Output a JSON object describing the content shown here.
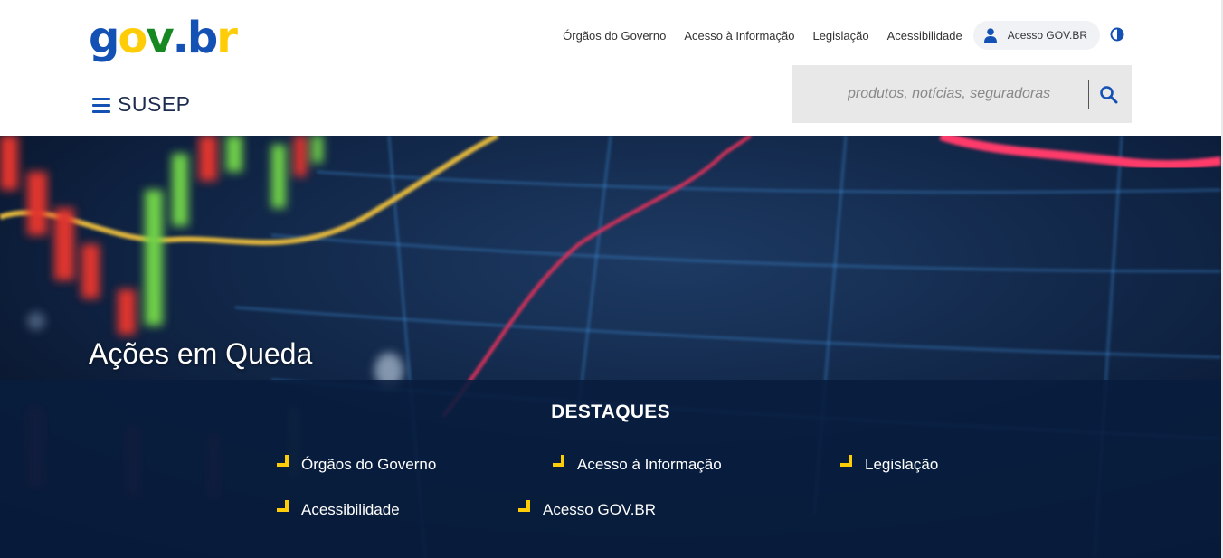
{
  "logo": {
    "parts": [
      "g",
      "o",
      "v",
      ".",
      "b",
      "r"
    ],
    "colors": [
      "#1351b4",
      "#ffcd07",
      "#168821",
      "#1351b4",
      "#1351b4",
      "#ffcd07"
    ]
  },
  "top_nav": {
    "links": [
      "Órgãos do Governo",
      "Acesso à Informação",
      "Legislação",
      "Acessibilidade"
    ],
    "login_label": "Acesso GOV.BR"
  },
  "site": {
    "name": "SUSEP"
  },
  "search": {
    "placeholder": "produtos, notícias, seguradoras"
  },
  "hero": {
    "title": "Ações em Queda"
  },
  "destaques": {
    "title": "DESTAQUES",
    "items": [
      "Órgãos do Governo",
      "Acesso à Informação",
      "Legislação",
      "Acessibilidade",
      "Acesso GOV.BR"
    ]
  },
  "colors": {
    "primary_blue": "#1351b4",
    "accent_yellow": "#ffcd07",
    "brand_green": "#168821",
    "navy_overlay": "#081c3e"
  },
  "icons": {
    "menu": "hamburger-icon",
    "user": "user-icon",
    "contrast": "contrast-icon",
    "search": "search-icon"
  }
}
